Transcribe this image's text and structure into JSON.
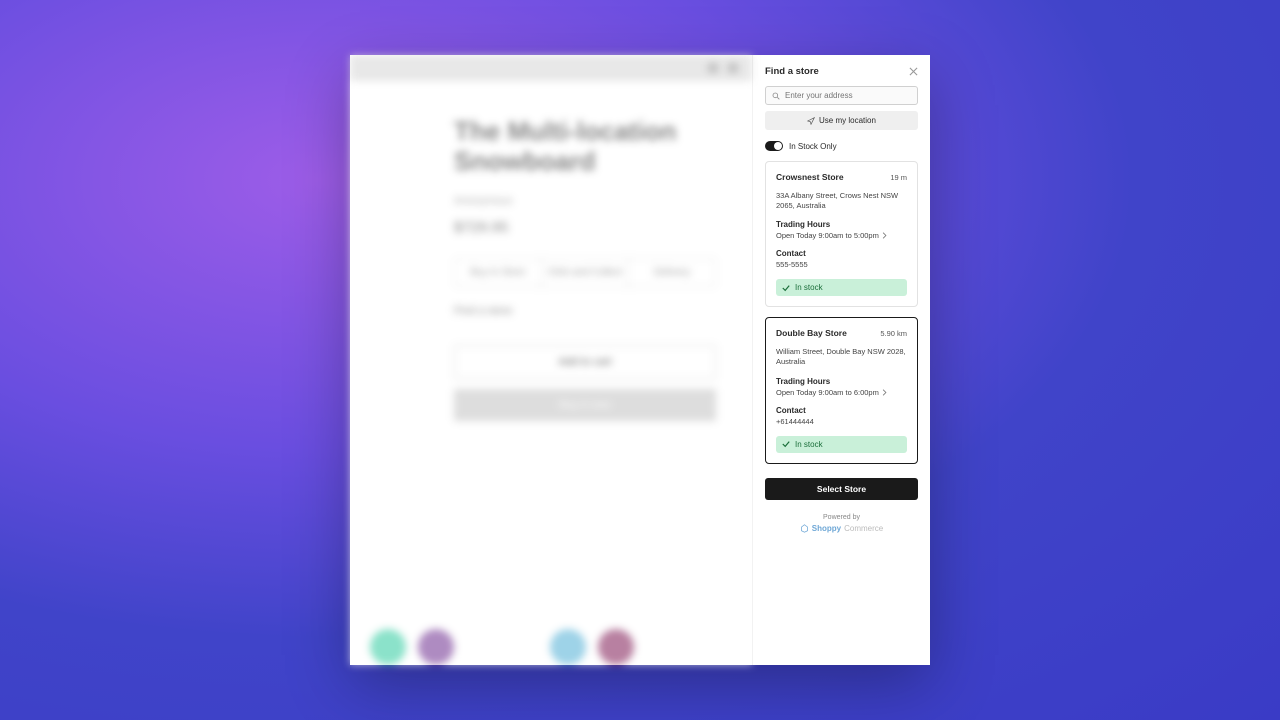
{
  "product": {
    "title": "The Multi-location Snowboard",
    "vendor": "Anonymous",
    "price": "$729.95",
    "tabs": [
      "Buy In Store",
      "Click and Collect",
      "Delivery"
    ],
    "find_store": "Find a store",
    "add_to_cart": "Add to cart",
    "buy_now": "Buy it now"
  },
  "drawer": {
    "title": "Find a store",
    "search_placeholder": "Enter your address",
    "use_location": "Use my location",
    "in_stock_only": "In Stock Only",
    "trading_hours_label": "Trading Hours",
    "contact_label": "Contact",
    "in_stock_label": "In stock",
    "select_store": "Select Store",
    "powered_by": "Powered by",
    "brand_main": "Shoppy",
    "brand_sub": "Commerce"
  },
  "stores": [
    {
      "name": "Crowsnest Store",
      "distance": "19 m",
      "address": "33A Albany Street, Crows Nest NSW 2065, Australia",
      "hours": "Open Today 9:00am to 5:00pm",
      "contact": "555-5555"
    },
    {
      "name": "Double Bay Store",
      "distance": "5.90 km",
      "address": "William Street, Double Bay NSW 2028, Australia",
      "hours": "Open Today 9:00am to 6:00pm",
      "contact": "+61444444"
    }
  ]
}
